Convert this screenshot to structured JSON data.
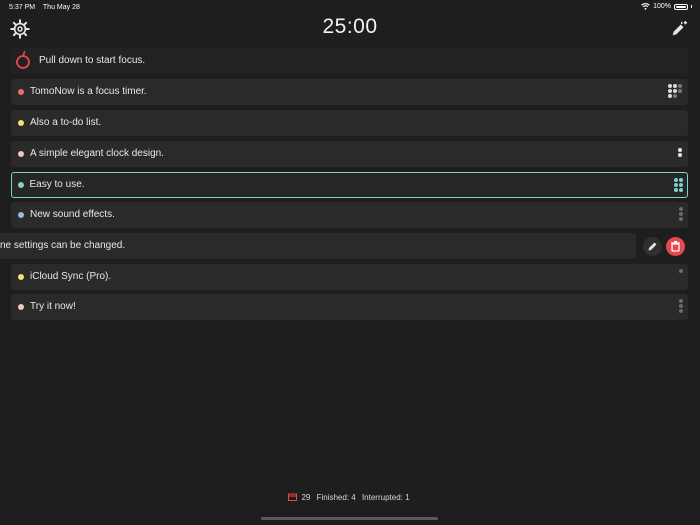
{
  "status_bar": {
    "time": "5:37 PM",
    "date": "Thu May 28",
    "battery": "100%"
  },
  "header": {
    "timer": "25:00"
  },
  "pull_hint": "Pull down to start focus.",
  "tasks": [
    {
      "label": "TomoNow is a focus timer.",
      "color": "#e8706d"
    },
    {
      "label": "Also a to-do list.",
      "color": "#f3de79"
    },
    {
      "label": "A simple elegant clock design.",
      "color": "#f3c6bd"
    },
    {
      "label": "Easy to use.",
      "color": "#7fd1c8"
    },
    {
      "label": "New sound effects.",
      "color": "#9db7e6"
    },
    {
      "label": "ne settings can be changed.",
      "color": ""
    },
    {
      "label": "iCloud Sync (Pro).",
      "color": "#f3de79"
    },
    {
      "label": "Try it now!",
      "color": "#f3c6bd"
    }
  ],
  "footer": {
    "count": "29",
    "finished": "Finished: 4",
    "interrupted": "Interrupted: 1"
  },
  "icons": {
    "settings": "gear-icon",
    "add": "pencil-plus-icon",
    "timer": "tomato-icon",
    "edit": "pencil-icon",
    "delete": "trash-icon",
    "calendar": "calendar-icon"
  },
  "colors": {
    "background": "#1e1e1e",
    "selected_border": "#7fd1c8",
    "delete": "#e8474c"
  }
}
